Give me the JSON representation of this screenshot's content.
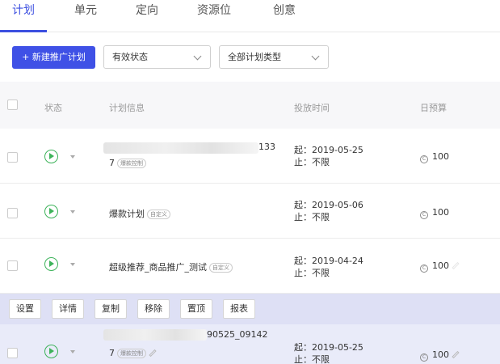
{
  "tabs": [
    {
      "label": "计划"
    },
    {
      "label": "单元"
    },
    {
      "label": "定向"
    },
    {
      "label": "资源位"
    },
    {
      "label": "创意"
    }
  ],
  "toolbar": {
    "new_plan_label": "+ 新建推广计划",
    "status_filter": "有效状态",
    "type_filter": "全部计划类型"
  },
  "table": {
    "headers": {
      "status": "状态",
      "info": "计划信息",
      "time": "投放时间",
      "budget": "日预算"
    },
    "rows": [
      {
        "name_line1": "_2... 133",
        "name_suffix": "133",
        "name_line2": "7",
        "tag": "爆款控制",
        "start": "起：2019-05-25",
        "end": "止：不限",
        "budget": "100"
      },
      {
        "name_line1": "爆款计划",
        "tag": "自定义",
        "start": "起：2019-05-06",
        "end": "止：不限",
        "budget": "100"
      },
      {
        "name_line1": "超级推荐_商品推广_测试",
        "tag": "自定义",
        "start": "起：2019-04-24",
        "end": "止：不限",
        "budget": "100"
      },
      {
        "name_suffix": "90525_09142",
        "name_line2": "7",
        "tag": "爆款控制",
        "start": "起：2019-05-25",
        "end": "止：不限",
        "budget": "100"
      }
    ]
  },
  "batch_actions": [
    "设置",
    "详情",
    "复制",
    "移除",
    "置顶",
    "报表"
  ],
  "colors": {
    "accent": "#3f51e6",
    "active_status": "#3db35a",
    "batch_bar": "#dee0f5"
  },
  "icons": {
    "status": "play-circle-icon",
    "budget": "coin-icon",
    "edit": "pencil-icon"
  }
}
